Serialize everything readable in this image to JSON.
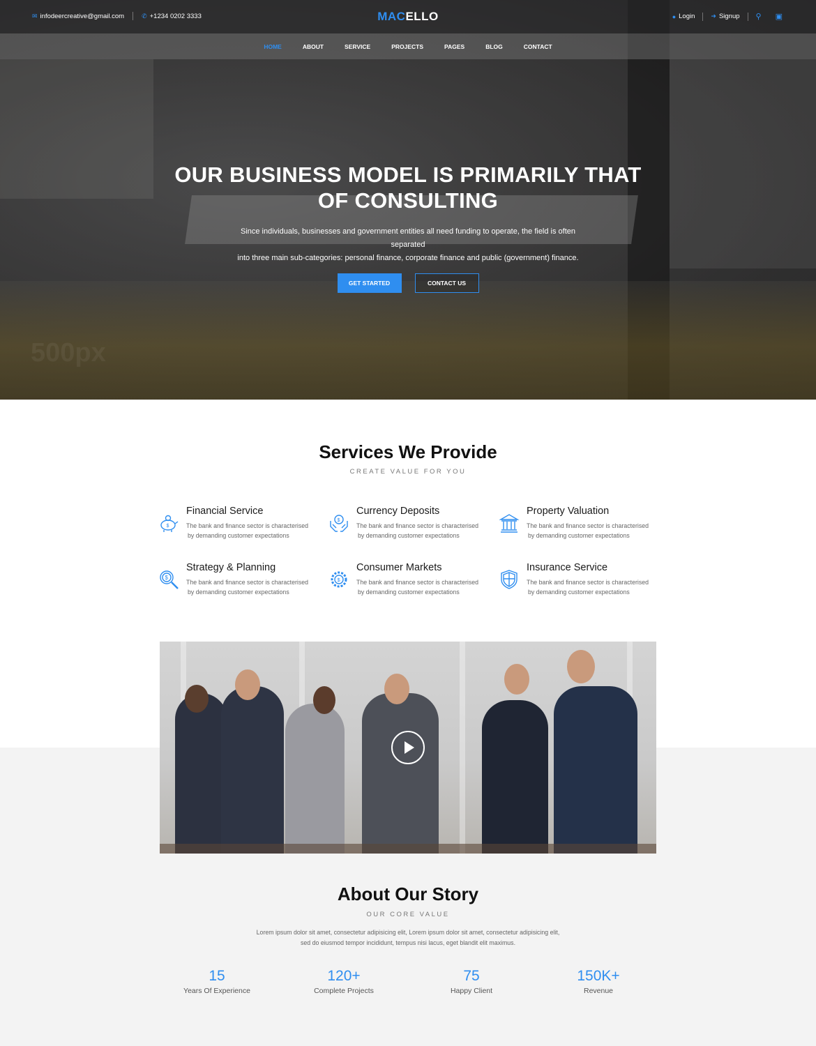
{
  "topbar": {
    "email": "infodeercreative@gmail.com",
    "phone": "+1234 0202 3333",
    "logo_part1": "MAC",
    "logo_part2": "ELLO",
    "login_label": "Login",
    "signup_label": "Signup",
    "icons": [
      "envelope-icon",
      "phone-icon",
      "user-icon",
      "sign-in-icon",
      "search-icon",
      "shopping-bag-icon"
    ]
  },
  "nav": {
    "items": [
      "HOME",
      "ABOUT",
      "SERVICE",
      "PROJECTS",
      "PAGES",
      "BLOG",
      "CONTACT"
    ],
    "active": "HOME"
  },
  "hero": {
    "title_line1": "OUR BUSINESS MODEL IS PRIMARILY THAT",
    "title_line2": "OF CONSULTING",
    "subtitle_line1": "Since individuals, businesses and government entities all need funding to operate, the field is often separated",
    "subtitle_line2": "into three main sub-categories: personal finance, corporate finance and public (government) finance.",
    "primary_button": "GET STARTED",
    "secondary_button": "CONTACT US",
    "watermark": "500px"
  },
  "services": {
    "title": "Services We Provide",
    "subtitle": "CREATE VALUE FOR YOU",
    "items": [
      {
        "title": "Financial Service",
        "icon": "piggy-bank-icon",
        "desc1": "The bank and finance sector is characterised",
        "desc2": "by demanding customer expectations"
      },
      {
        "title": "Currency Deposits",
        "icon": "hands-coin-icon",
        "desc1": "The bank and finance sector is characterised",
        "desc2": "by demanding customer expectations"
      },
      {
        "title": "Property Valuation",
        "icon": "bank-building-icon",
        "desc1": "The bank and finance sector is characterised",
        "desc2": "by demanding customer expectations"
      },
      {
        "title": "Strategy & Planning",
        "icon": "magnifier-dollar-icon",
        "desc1": "The bank and finance sector is characterised",
        "desc2": "by demanding customer expectations"
      },
      {
        "title": "Consumer Markets",
        "icon": "gear-dollar-icon",
        "desc1": "The bank and finance sector is characterised",
        "desc2": "by demanding customer expectations"
      },
      {
        "title": "Insurance Service",
        "icon": "shield-icon",
        "desc1": "The bank and finance sector is characterised",
        "desc2": "by demanding customer expectations"
      }
    ]
  },
  "video": {
    "icon": "play-icon"
  },
  "about": {
    "title": "About Our Story",
    "subtitle": "OUR CORE VALUE",
    "text_line1": "Lorem ipsum dolor sit amet, consectetur adipisicing elit, Lorem ipsum dolor sit amet, consectetur adipisicing elit,",
    "text_line2": "sed do eiusmod tempor incididunt, tempus nisi lacus, eget blandit elit maximus.",
    "stats": [
      {
        "value": "15",
        "label": "Years Of Experience"
      },
      {
        "value": "120+",
        "label": "Complete Projects"
      },
      {
        "value": "75",
        "label": "Happy Client"
      },
      {
        "value": "150K+",
        "label": "Revenue"
      }
    ]
  },
  "colors": {
    "accent": "#2f8ef0",
    "heading": "#111111",
    "muted": "#666666",
    "about_bg": "#f3f3f3"
  }
}
